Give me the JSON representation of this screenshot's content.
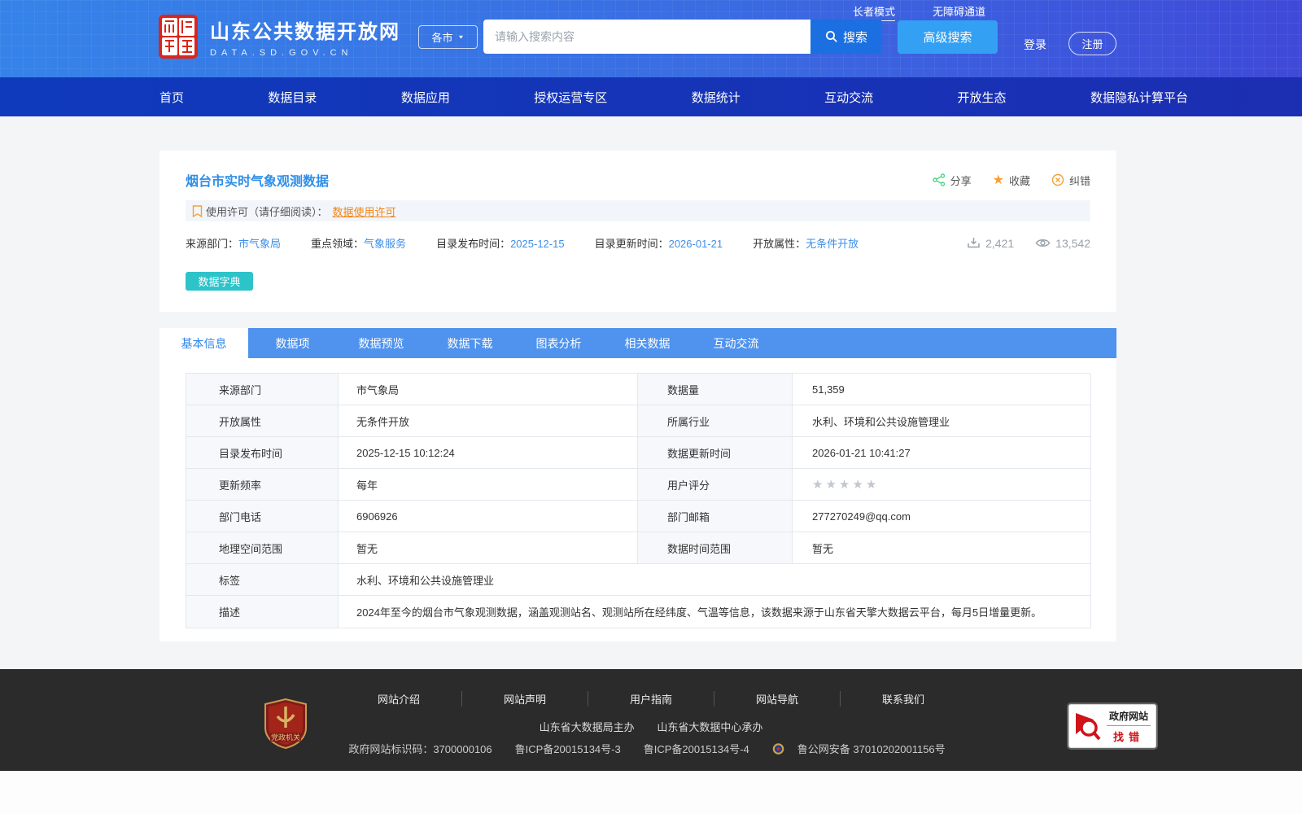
{
  "header": {
    "elder_mode": "长者模式",
    "accessibility": "无障碍通道",
    "site_name": "山东公共数据开放网",
    "site_domain": "DATA.SD.GOV.CN",
    "city_selector": "各市",
    "search_placeholder": "请输入搜索内容",
    "search_button": "搜索",
    "advanced_search_button": "高级搜索",
    "login": "登录",
    "register": "注册"
  },
  "nav": {
    "items": [
      {
        "label": "首页"
      },
      {
        "label": "数据目录"
      },
      {
        "label": "数据应用"
      },
      {
        "label": "授权运营专区"
      },
      {
        "label": "数据统计"
      },
      {
        "label": "互动交流"
      },
      {
        "label": "开放生态"
      },
      {
        "label": "数据隐私计算平台"
      }
    ]
  },
  "dataset": {
    "title": "烟台市实时气象观测数据",
    "actions": {
      "share": "分享",
      "favorite": "收藏",
      "report_error": "纠错"
    },
    "license_label": "使用许可（请仔细阅读）：",
    "license_link": "数据使用许可",
    "meta": [
      {
        "label": "来源部门：",
        "value": "市气象局"
      },
      {
        "label": "重点领域：",
        "value": "气象服务"
      },
      {
        "label": "目录发布时间：",
        "value": "2025-12-15"
      },
      {
        "label": "目录更新时间：",
        "value": "2026-01-21"
      },
      {
        "label": "开放属性：",
        "value": "无条件开放"
      }
    ],
    "download_count": "2,421",
    "view_count": "13,542",
    "data_dictionary_button": "数据字典"
  },
  "tabs": [
    {
      "label": "基本信息",
      "active": true
    },
    {
      "label": "数据项",
      "active": false
    },
    {
      "label": "数据预览",
      "active": false
    },
    {
      "label": "数据下载",
      "active": false
    },
    {
      "label": "图表分析",
      "active": false
    },
    {
      "label": "相关数据",
      "active": false
    },
    {
      "label": "互动交流",
      "active": false
    }
  ],
  "info_table": {
    "rows": [
      {
        "label1": "来源部门",
        "value1": "市气象局",
        "label2": "数据量",
        "value2": "51,359"
      },
      {
        "label1": "开放属性",
        "value1": "无条件开放",
        "label2": "所属行业",
        "value2": "水利、环境和公共设施管理业"
      },
      {
        "label1": "目录发布时间",
        "value1": "2025-12-15 10:12:24",
        "label2": "数据更新时间",
        "value2": "2026-01-21 10:41:27"
      },
      {
        "label1": "更新频率",
        "value1": "每年",
        "label2": "用户评分",
        "rating": {
          "total": 5,
          "filled": 0
        }
      },
      {
        "label1": "部门电话",
        "value1": "6906926",
        "label2": "部门邮箱",
        "value2": "277270249@qq.com"
      },
      {
        "label1": "地理空间范围",
        "value1": "暂无",
        "label2": "数据时间范围",
        "value2": "暂无"
      }
    ],
    "tag_row": {
      "label": "标签",
      "value": "水利、环境和公共设施管理业"
    },
    "desc_row": {
      "label": "描述",
      "value": "2024年至今的烟台市气象观测数据，涵盖观测站名、观测站所在经纬度、气温等信息，该数据来源于山东省天擎大数据云平台，每月5日增量更新。"
    }
  },
  "footer": {
    "links": [
      {
        "label": "网站介绍"
      },
      {
        "label": "网站声明"
      },
      {
        "label": "用户指南"
      },
      {
        "label": "网站导航"
      },
      {
        "label": "联系我们"
      }
    ],
    "organizer": "山东省大数据局主办",
    "undertaker": "山东省大数据中心承办",
    "site_id": "政府网站标识码：3700000106",
    "icp1": "鲁ICP备20015134号-3",
    "icp2": "鲁ICP备20015134号-4",
    "police_record": "鲁公网安备 37010202001156号",
    "party_badge": "党政机关",
    "find_error_badge": {
      "line1": "政府网站",
      "line2": "找错"
    }
  },
  "icons": {
    "star": "★",
    "caret_down": "▼"
  },
  "colors": {
    "header_gradient_left": "#3583e9",
    "header_gradient_right": "#3f49d8",
    "nav_blue": "#1535b8",
    "tab_blue": "#4f93ee",
    "link_blue": "#3d8ee9",
    "teal_button": "#2cc3c9",
    "orange_accent": "#f5a033",
    "green_share": "#4fd483",
    "footer_dark": "#2b2b2b"
  }
}
